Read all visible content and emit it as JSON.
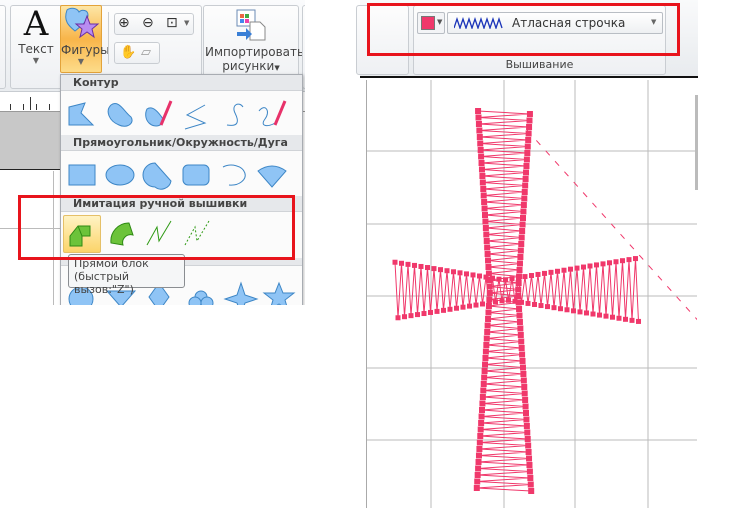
{
  "ribbon": {
    "text_label": "Текст",
    "shapes_label": "Фигуры",
    "import_label_1": "Импортировать",
    "import_label_2": "рисунки",
    "text_glyph": "A"
  },
  "shapes_menu": {
    "sections": [
      {
        "title": "Контур"
      },
      {
        "title": "Прямоугольник/Окружность/Дуга"
      },
      {
        "title": "Имитация ручной вышивки"
      }
    ],
    "tooltip": {
      "line1": "Прямой блок",
      "line2": "(быстрый вызов:\"Z\")"
    }
  },
  "embroidery": {
    "stitch_type": "Атласная строчка",
    "group_label": "Вышивание",
    "thread_color": "#f0386b"
  },
  "colors": {
    "accent_red": "#e8141c",
    "shape_blue": "#8fc4f5",
    "stitch_green": "#5cbf2a",
    "stitch_pink": "#f0386b"
  }
}
